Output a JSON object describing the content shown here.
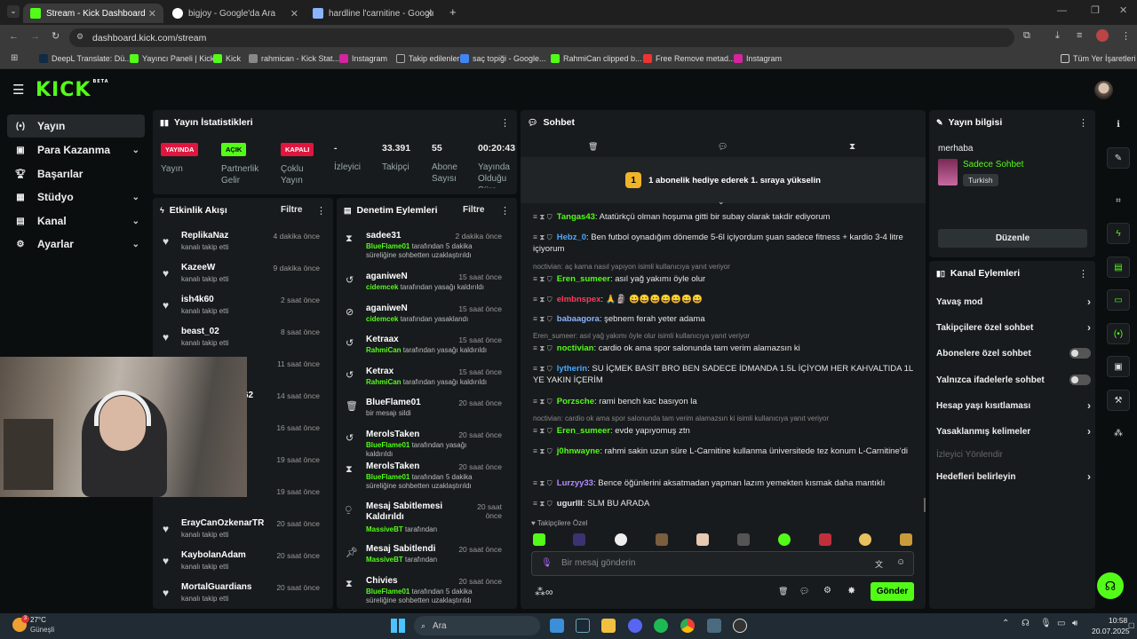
{
  "browser": {
    "tabs": [
      {
        "title": "Stream - Kick Dashboard",
        "active": true
      },
      {
        "title": "bigjoy - Google'da Ara",
        "active": false
      },
      {
        "title": "hardline l'carnitine - Google Al",
        "active": false
      }
    ],
    "url": "dashboard.kick.com/stream",
    "bookmarks": [
      "DeepL Translate: Dü...",
      "Yayıncı Paneli | Kick",
      "Kick",
      "rahmican - Kick Stat...",
      "Instagram",
      "Takip edilenler",
      "saç topiği - Google...",
      "RahmiCan clipped b...",
      "Free Remove metad...",
      "Instagram"
    ],
    "all_bookmarks": "Tüm Yer İşaretleri"
  },
  "brand": {
    "logo": "KICK",
    "beta": "BETA",
    "accent": "#53fc18"
  },
  "sidebar": {
    "items": [
      {
        "label": "Yayın",
        "icon": "broadcast-icon",
        "selected": true
      },
      {
        "label": "Para Kazanma",
        "icon": "money-icon",
        "chevron": true
      },
      {
        "label": "Başarılar",
        "icon": "trophy-icon"
      },
      {
        "label": "Stüdyo",
        "icon": "studio-icon",
        "chevron": true
      },
      {
        "label": "Kanal",
        "icon": "channel-icon",
        "chevron": true
      },
      {
        "label": "Ayarlar",
        "icon": "gear-icon",
        "chevron": true
      }
    ]
  },
  "stats": {
    "title": "Yayın İstatistikleri",
    "items": [
      {
        "badge": "YAYINDA",
        "label": "Yayın"
      },
      {
        "badge": "AÇIK",
        "label": "Partnerlik Gelir Programı"
      },
      {
        "badge": "KAPALI",
        "label": "Çoklu Yayın"
      },
      {
        "value": "-",
        "label": "İzleyici"
      },
      {
        "value": "33.391",
        "label": "Takipçi"
      },
      {
        "value": "55",
        "label": "Abone Sayısı"
      },
      {
        "value": "00:20:43",
        "label": "Yayında Olduğu Süre"
      }
    ]
  },
  "activity": {
    "title": "Etkinlik Akışı",
    "filter": "Filtre",
    "items": [
      {
        "name": "ReplikaNaz",
        "sub": "kanalı takip etti",
        "time": "4 dakika önce"
      },
      {
        "name": "KazeeW",
        "sub": "kanalı takip etti",
        "time": "9 dakika önce"
      },
      {
        "name": "ish4k60",
        "sub": "kanalı takip etti",
        "time": "2 saat önce"
      },
      {
        "name": "beast_02",
        "sub": "kanalı takip etti",
        "time": "8 saat önce"
      },
      {
        "name": "",
        "sub": "",
        "time": "11 saat önce"
      },
      {
        "name": "62",
        "sub": "",
        "time": "14 saat önce"
      },
      {
        "name": "",
        "sub": "",
        "time": "16 saat önce"
      },
      {
        "name": "",
        "sub": "",
        "time": "19 saat önce"
      },
      {
        "name": "",
        "sub": "",
        "time": "19 saat önce"
      },
      {
        "name": "ErayCanOzkenarTR",
        "sub": "kanalı takip etti",
        "time": "20 saat önce"
      },
      {
        "name": "KaybolanAdam",
        "sub": "kanalı takip etti",
        "time": "20 saat önce"
      },
      {
        "name": "MortalGuardians",
        "sub": "kanalı takip etti",
        "time": "20 saat önce"
      }
    ]
  },
  "moderation": {
    "title": "Denetim Eylemleri",
    "filter": "Filtre",
    "items": [
      {
        "icon": "hourglass-icon",
        "name": "sadee31",
        "time": "2 dakika önce",
        "by": "BlueFlame01",
        "desc": " tarafından 5 dakika süreliğine sohbetten uzaklaştırıldı"
      },
      {
        "icon": "undo-icon",
        "name": "aganiweN",
        "time": "15 saat önce",
        "by": "cidemcek",
        "desc": " tarafından yasağı kaldırıldı"
      },
      {
        "icon": "ban-icon",
        "name": "aganiweN",
        "time": "15 saat önce",
        "by": "cidemcek",
        "desc": " tarafından yasaklandı"
      },
      {
        "icon": "undo-icon",
        "name": "Ketraax",
        "time": "15 saat önce",
        "by": "RahmiCan",
        "desc": " tarafından yasağı kaldırıldı"
      },
      {
        "icon": "undo-icon",
        "name": "Ketrax",
        "time": "15 saat önce",
        "by": "RahmiCan",
        "desc": " tarafından yasağı kaldırıldı"
      },
      {
        "icon": "trash-icon",
        "name": "BlueFlame01",
        "time": "20 saat önce",
        "by": "",
        "desc": "bir mesajı sildi"
      },
      {
        "icon": "undo-icon",
        "name": "MerolsTaken",
        "time": "20 saat önce",
        "by": "BlueFlame01",
        "desc": " tarafından yasağı kaldırıldı"
      },
      {
        "icon": "hourglass-icon",
        "name": "MerolsTaken",
        "time": "20 saat önce",
        "by": "BlueFlame01",
        "desc": " tarafından 5 dakika süreliğine sohbetten uzaklaştırıldı"
      },
      {
        "icon": "unpin-icon",
        "name": "Mesaj Sabitlemesi Kaldırıldı",
        "time": "20 saat önce",
        "by": "MassiveBT",
        "desc": " tarafından"
      },
      {
        "icon": "pin-icon",
        "name": "Mesaj Sabitlendi",
        "time": "20 saat önce",
        "by": "MassiveBT",
        "desc": " tarafından"
      },
      {
        "icon": "hourglass-icon",
        "name": "Chivies",
        "time": "20 saat önce",
        "by": "BlueFlame01",
        "desc": " tarafından 5 dakika süreliğine sohbetten uzaklaştırıldı"
      }
    ]
  },
  "chat": {
    "title": "Sohbet",
    "gift_banner": "1 abonelik hediye ederek 1. sıraya yükselin",
    "gift_rank": "1",
    "messages": [
      {
        "user": "Tangas43",
        "color": "#53fc18",
        "text": ": Atatürkçü olman hoşuma gitti bir subay olarak takdir ediyorum"
      },
      {
        "user": "Hebz_0",
        "color": "#4aa8ff",
        "text": ": Ben futbol oynadığım dönemde 5-6l içiyordum şuan sadece fitness + kardio 3-4 litre içiyorum"
      },
      {
        "reply": "noctivian: aç karna nasıl yapıyon isimli kullanıcıya yanıt veriyor"
      },
      {
        "user": "Eren_sumeer",
        "color": "#53fc18",
        "text": ": asıl yağ yakımı öyle olur"
      },
      {
        "user": "elmbnspex",
        "color": "#ff3b5c",
        "text": ": 🙏🗿 😀😀😀😀😀😀😀"
      },
      {
        "user": "babaagora",
        "color": "#8ab4ff",
        "text": ": şebnem ferah yeter adama"
      },
      {
        "reply": "Eren_sumeer: asıl yağ yakımı öyle olur isimli kullanıcıya yanıt veriyor"
      },
      {
        "user": "noctivian",
        "color": "#53fc18",
        "text": ": cardio ok ama spor salonunda tam verim alamazsın ki"
      },
      {
        "user": "lytherin",
        "color": "#4aa8ff",
        "text": ": SU İÇMEK BASİT BRO BEN SADECE İDMANDA 1.5L İÇİYOM HER KAHVALTIDA 1L YE YAKIN İÇERİM"
      },
      {
        "user": "Porzsche",
        "color": "#53fc18",
        "text": ": rami bench kac basıyon la"
      },
      {
        "reply": "noctivian: cardio ok ama spor salonunda tam verim alamazsın ki isimli kullanıcıya yanıt veriyor"
      },
      {
        "user": "Eren_sumeer",
        "color": "#53fc18",
        "text": ": evde yapıyomuş ztn"
      },
      {
        "user": "j0hnwayne",
        "color": "#53fc18",
        "text": ": rahmi sakin uzun süre L-Carnitine kullanma üniversitede tez konum L-Carnitine'di"
      },
      {
        "user": "Lurzyy33",
        "color": "#b48cff",
        "text": ": Bence öğünlerini aksatmadan yapman lazım yemekten kısmak daha mantıklı"
      },
      {
        "user": "ugurlll",
        "color": "#e6e6e6",
        "text": ": SLM BU ARADA"
      }
    ],
    "follower_emotes": "Takipçilere Özel",
    "placeholder": "Bir mesaj gönderin",
    "send": "Gönder"
  },
  "stream_info": {
    "title": "Yayın bilgisi",
    "stream_title": "merhaba",
    "category": "Sadece Sohbet",
    "tag": "Turkish",
    "edit": "Düzenle"
  },
  "channel_actions": {
    "title": "Kanal Eylemleri",
    "items": [
      {
        "label": "Yavaş mod",
        "type": "arrow"
      },
      {
        "label": "Takipçilere özel sohbet",
        "type": "arrow"
      },
      {
        "label": "Abonelere özel sohbet",
        "type": "toggle"
      },
      {
        "label": "Yalnızca ifadelerle sohbet",
        "type": "toggle"
      },
      {
        "label": "Hesap yaşı kısıtlaması",
        "type": "arrow"
      },
      {
        "label": "Yasaklanmış kelimeler",
        "type": "arrow"
      },
      {
        "label": "İzleyici Yönlendir",
        "type": "disabled"
      },
      {
        "label": "Hedefleri belirleyin",
        "type": "arrow"
      }
    ]
  },
  "taskbar": {
    "weather_temp": "27°C",
    "weather_desc": "Güneşli",
    "weather_badge": "3",
    "search": "Ara",
    "time": "10:58",
    "date": "20.07.2025"
  }
}
